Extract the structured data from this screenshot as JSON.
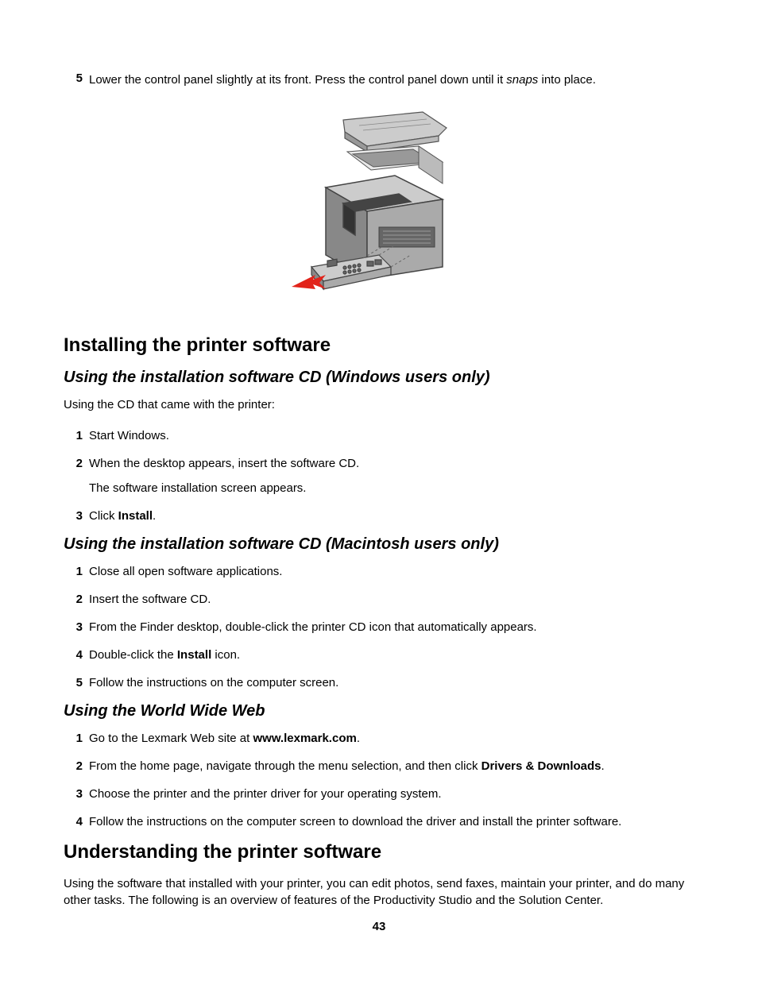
{
  "step5": {
    "num": "5",
    "text_before": "Lower the control panel slightly at its front. Press the control panel down until it ",
    "italic_word": "snaps",
    "text_after": " into place."
  },
  "heading_installing": "Installing the printer software",
  "subheading_windows": "Using the installation software CD (Windows users only)",
  "intro_windows": "Using the CD that came with the printer:",
  "windows_steps": {
    "s1": "Start Windows.",
    "s2_main": "When the desktop appears, insert the software CD.",
    "s2_sub": "The software installation screen appears.",
    "s3_before": "Click ",
    "s3_bold": "Install",
    "s3_after": "."
  },
  "subheading_mac": "Using the installation software CD (Macintosh users only)",
  "mac_steps": {
    "s1": "Close all open software applications.",
    "s2": "Insert the software CD.",
    "s3": "From the Finder desktop, double-click the printer CD icon that automatically appears.",
    "s4_before": "Double-click the ",
    "s4_bold": "Install",
    "s4_after": " icon.",
    "s5": "Follow the instructions on the computer screen."
  },
  "subheading_web": "Using the World Wide Web",
  "web_steps": {
    "s1_before": "Go to the Lexmark Web site at ",
    "s1_bold": "www.lexmark.com",
    "s1_after": ".",
    "s2_before": "From the home page, navigate through the menu selection, and then click ",
    "s2_bold": "Drivers & Downloads",
    "s2_after": ".",
    "s3": "Choose the printer and the printer driver for your operating system.",
    "s4": "Follow the instructions on the computer screen to download the driver and install the printer software."
  },
  "heading_understanding": "Understanding the printer software",
  "intro_understanding": "Using the software that installed with your printer, you can edit photos, send faxes, maintain your printer, and do many other tasks. The following is an overview of features of the Productivity Studio and the Solution Center.",
  "page_number": "43"
}
